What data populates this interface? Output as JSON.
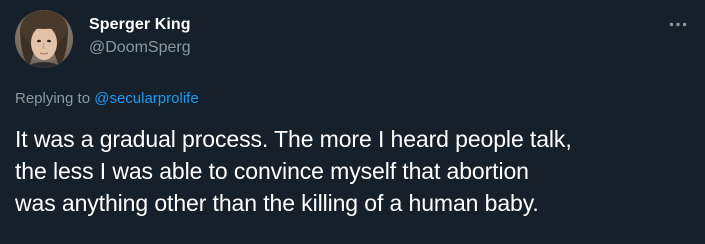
{
  "author": {
    "display_name": "Sperger King",
    "handle": "@DoomSperg",
    "avatar_icon": "user-avatar-photo"
  },
  "menu": {
    "icon": "more-horizontal-icon"
  },
  "reply": {
    "prefix": "Replying to ",
    "mention": "@secularprolife"
  },
  "tweet": {
    "text": "It was a gradual process.  The more I heard people talk,\nthe less I was able to convince myself that abortion\nwas anything other than the killing of a human baby."
  },
  "colors": {
    "background": "#15202b",
    "text_primary": "#ffffff",
    "text_secondary": "#8b98a5",
    "link": "#1d9bf0"
  }
}
